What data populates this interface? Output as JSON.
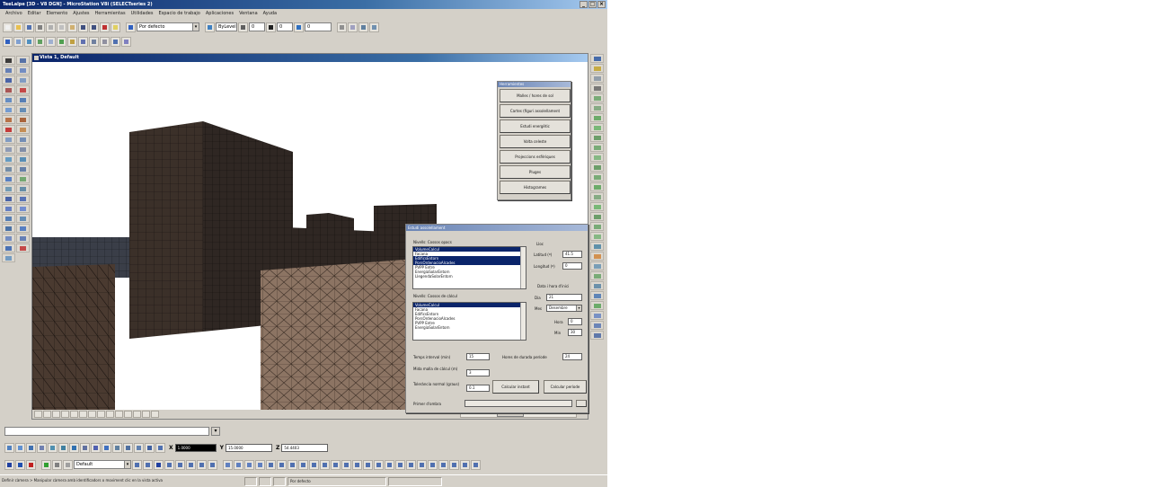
{
  "window": {
    "title": "TeeLalpe [3D - V8 DGN] - MicroStation V8i (SELECTseries 2)",
    "controls": [
      "_",
      "□",
      "×"
    ]
  },
  "menu": [
    "Archivo",
    "Editar",
    "Elemento",
    "Ajustes",
    "Herramientas",
    "Utilidades",
    "Espacio de trabajo",
    "Aplicaciones",
    "Ventana",
    "Ayuda"
  ],
  "toolbar": {
    "level_combo": "Por defecto",
    "color_combo": "ByLevel",
    "style_combo": "0",
    "weight_combo": "0",
    "priority_combo": "0"
  },
  "view": {
    "title": "Vista 1, Default"
  },
  "tools_dialog": {
    "title": "Herramientes",
    "buttons": [
      "Malles / hores de sol",
      "Cartes (figuri assolellament",
      "Estudi energètic",
      "Volta celeste",
      "Projeccions esfèriques",
      "Pluges",
      "Histogrames"
    ]
  },
  "solar_dialog": {
    "title": "Estudi assolellament",
    "level_list_label": "Nivells: Cossos opacs",
    "level_list_items": [
      "VolumeCalcul",
      "Facana",
      "EdificsEntorn",
      "PorsOrdenacioAlcades",
      "PVPP Entre",
      "EnergiaSolarEntorn",
      "LlegendaSolarEntorn"
    ],
    "level_list_selected": [
      0,
      2,
      3
    ],
    "calc_list_label": "Nivells: Cossos de càlcul",
    "calc_list_items": [
      "VolumeCalcul",
      "Facana",
      "EdificsEntorn",
      "PorsOrdenacioAlcades",
      "PVPP Entre",
      "EnergiaSolarEntorn"
    ],
    "calc_list_selected": [
      0
    ],
    "location_label": "Lloc",
    "latitude_label": "Latitud (º)",
    "latitude_value": "41.5",
    "longitude_label": "Longitud (º)",
    "longitude_value": "0",
    "date_label": "Data i hora d'inici",
    "day_label": "Dia",
    "day_value": "21",
    "month_label": "Mes",
    "month_value": "Desembre",
    "hour_label": "Hora",
    "hour_value": "0",
    "min_label": "Min",
    "min_value": "30",
    "interval_label": "Temps interval (min)",
    "interval_value": "15",
    "duration_label": "Hores de durada període",
    "duration_value": "24",
    "mesh_label": "Mida malla de càlcul (m)",
    "mesh_value": "3",
    "tolerance_label": "Tolerància normal (graus)",
    "tolerance_value": "0.1",
    "calc_instant_button": "Calcular instant",
    "calc_period_button": "Calcular període",
    "first_shadow_label": "Primer d'ombra"
  },
  "coords": {
    "x_label": "X",
    "x_value": "1.0000",
    "y_label": "Y",
    "y_value": "15.0000",
    "z_label": "Z",
    "z_value": "54.4403"
  },
  "bottom_toolbar": {
    "view_combo": "Default"
  },
  "status": {
    "message": "Definir càmera > Manipular càmera amb identificadors o moviment clic en la vista activa",
    "level": "Por defecto"
  },
  "colors": {
    "chrome": "#d4d0c8",
    "title_blue": "#0a246a",
    "building_dark": "#3b3029",
    "building_light": "#8c7463",
    "selection": "#0a246a"
  }
}
